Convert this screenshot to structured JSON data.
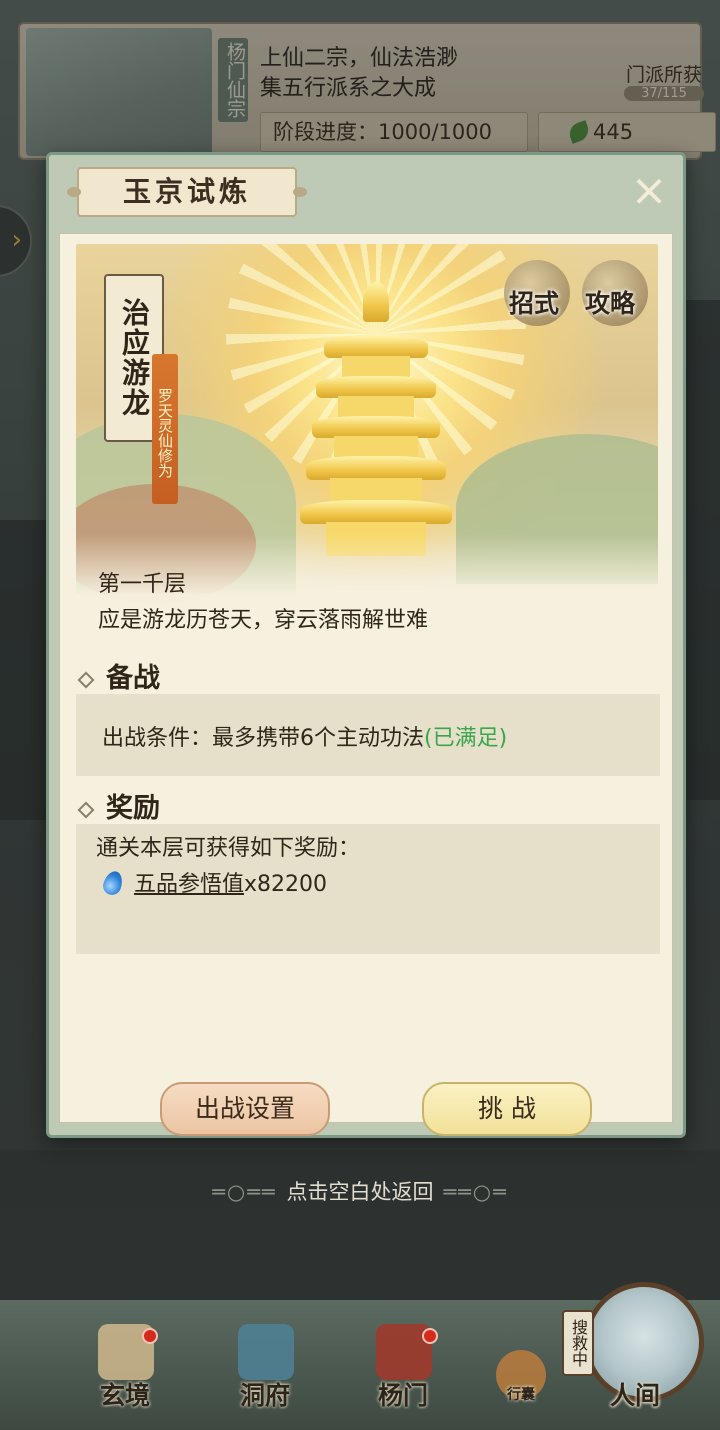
{
  "sect": {
    "name": "杨门仙宗",
    "desc_line1": "上仙二宗，仙法浩渺",
    "desc_line2": "集五行派系之大成",
    "progress": "阶段进度：1000/1000",
    "resource": "445",
    "gain_label": "门派所获",
    "gain_count": "37/115"
  },
  "dialog": {
    "title": "玉京试炼",
    "close_icon": "×",
    "banner": {
      "scroll_title": "治应游龙",
      "tag": "罗天灵仙修为",
      "btn_moves": "招式",
      "btn_guide": "攻略"
    },
    "floor_name": "第一千层",
    "floor_desc": "应是游龙历苍天，穿云落雨解世难",
    "prepare": {
      "title": "备战",
      "condition": "出战条件：最多携带6个主动功法",
      "condition_status": "(已满足)"
    },
    "reward": {
      "title": "奖励",
      "intro": "通关本层可获得如下奖励：",
      "item_name": "五品参悟值",
      "item_count": "x82200",
      "item_icon": "water-drop-icon"
    },
    "btn_setting": "出战设置",
    "btn_challenge": "挑 战"
  },
  "back_hint": "点击空白处返回",
  "nav": {
    "items": [
      {
        "label": "玄境"
      },
      {
        "label": "洞府"
      },
      {
        "label": "杨门"
      },
      {
        "label": "行囊"
      },
      {
        "label": "人间"
      }
    ],
    "search_tag": "搜救中"
  },
  "colors": {
    "ok_green": "#3aa54d",
    "dialog_frame": "#7d9986",
    "paper": "#f6f1df"
  }
}
